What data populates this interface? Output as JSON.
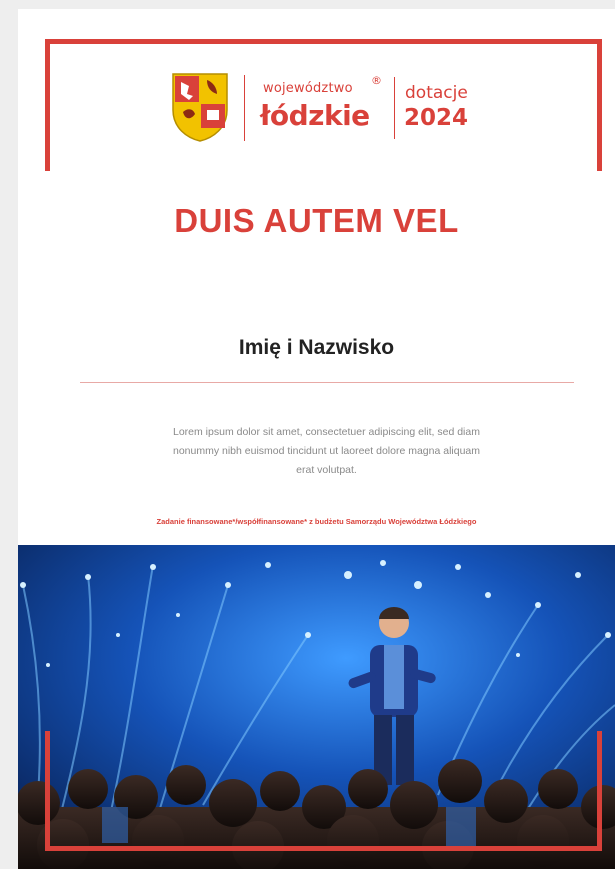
{
  "logo": {
    "region_small": "województwo",
    "registered_mark": "®",
    "region_big": "łódzkie",
    "grant_word": "dotacje",
    "grant_year": "2024",
    "crest_icon": "voivodeship-coat-of-arms"
  },
  "title": "DUIS AUTEM VEL",
  "recipient_name": "Imię i Nazwisko",
  "body_lines": [
    "Lorem ipsum dolor sit amet, consectetuer adipiscing elit, sed diam",
    "nonummy nibh euismod tincidunt ut laoreet dolore magna aliquam",
    "erat volutpat."
  ],
  "funding_note": "Zadanie finansowane*/współfinansowane* z budżetu Samorządu Województwa Łódzkiego",
  "photo": {
    "subject": "speaker-on-stage-with-audience",
    "colors": {
      "deep": "#0a2a66",
      "glow": "#5fb6ff",
      "spark": "#d6f0ff"
    }
  },
  "colors": {
    "accent": "#d9413a",
    "text": "#222222",
    "muted": "#8a8a8a"
  }
}
